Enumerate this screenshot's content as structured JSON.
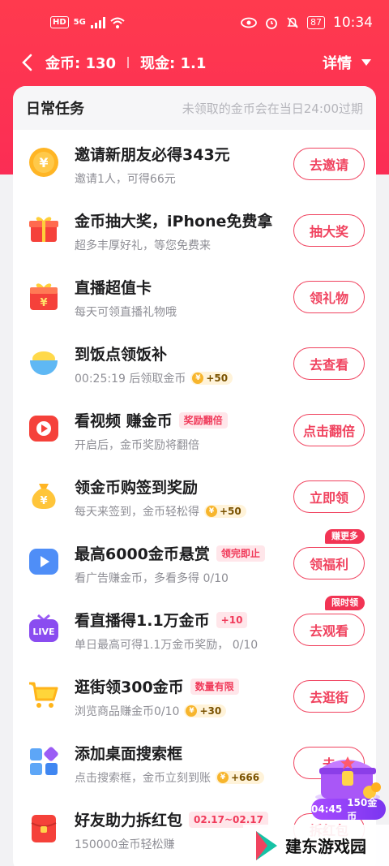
{
  "status_bar": {
    "left": [
      "HD",
      "5G"
    ],
    "battery": "87",
    "time": "10:34"
  },
  "header": {
    "coins_label": "金币: 130",
    "cash_label": "现金: 1.1",
    "detail_label": "详情"
  },
  "card": {
    "title": "日常任务",
    "note": "未领取的金币会在当日24:00过期"
  },
  "tasks": [
    {
      "title": "邀请新朋友必得343元",
      "subtitle": "邀请1人，可得66元",
      "button": "去邀请",
      "icon": "coin-icon"
    },
    {
      "title": "金币抽大奖，iPhone免费拿",
      "subtitle": "超多丰厚好礼，等您免费来",
      "button": "抽大奖",
      "icon": "gift-box-icon"
    },
    {
      "title": "直播超值卡",
      "subtitle": "每天可领直播礼物哦",
      "button": "领礼物",
      "icon": "gift-card-icon"
    },
    {
      "title": "到饭点领饭补",
      "subtitle": "00:25:19 后领取金币",
      "badge": "+50",
      "button": "去查看",
      "icon": "rice-bowl-icon"
    },
    {
      "title": "看视频 赚金币",
      "tag": "奖励翻倍",
      "subtitle": "开启后，金币奖励将翻倍",
      "button": "点击翻倍",
      "icon": "video-play-icon"
    },
    {
      "title": "领金币购签到奖励",
      "subtitle": "每天来签到，金币轻松得",
      "badge": "+50",
      "button": "立即领",
      "icon": "money-bag-icon"
    },
    {
      "title": "最高6000金币悬赏",
      "tag": "领完即止",
      "subtitle": "看广告赚金币，多看多得 0/10",
      "button": "领福利",
      "button_badge": "赚更多",
      "icon": "ad-play-icon"
    },
    {
      "title": "看直播得1.1万金币",
      "tag": "+10",
      "subtitle": "单日最高可得1.1万金币奖励，  0/10",
      "button": "去观看",
      "button_badge": "限时领",
      "icon": "live-tv-icon"
    },
    {
      "title": "逛街领300金币",
      "tag": "数量有限",
      "subtitle": "浏览商品赚金币0/10",
      "badge": "+30",
      "button": "去逛街",
      "icon": "shopping-cart-icon"
    },
    {
      "title": "添加桌面搜索框",
      "subtitle": "点击搜索框，金币立刻到账",
      "badge": "+666",
      "button": "去",
      "icon": "apps-grid-icon"
    },
    {
      "title": "好友助力拆红包",
      "tag": "02.17~02.17",
      "subtitle": "150000金币轻松赚",
      "button": "拆红包",
      "icon": "red-packet-icon"
    }
  ],
  "float_widget": {
    "timer": "04:45",
    "reward": "150金币"
  },
  "watermark": {
    "text": "建东游戏园"
  },
  "colors": {
    "brand_red": "#fb2d55",
    "button_red": "#f0435f"
  }
}
